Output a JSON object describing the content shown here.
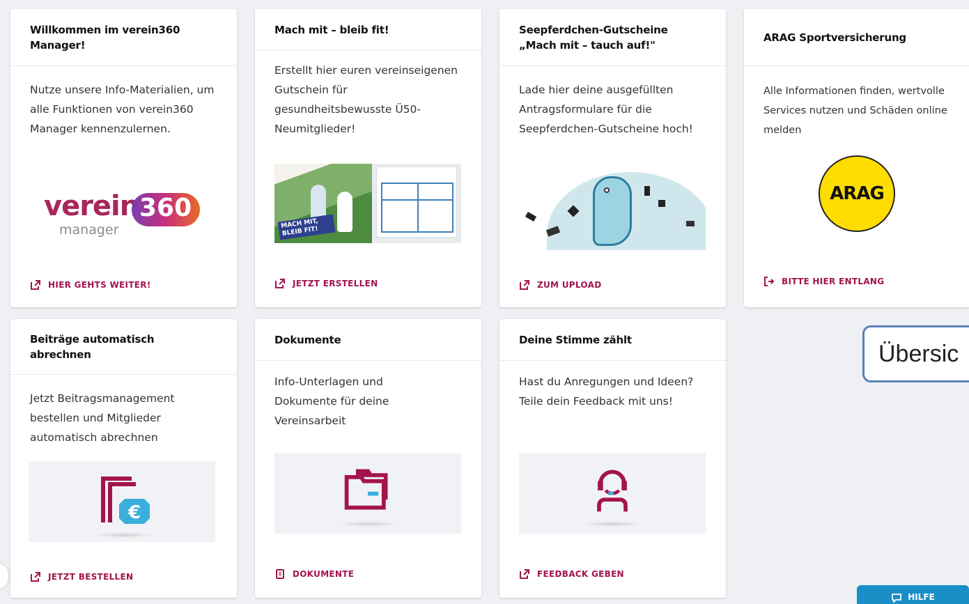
{
  "cards": [
    {
      "title": "Willkommen im verein360 Manager!",
      "text": "Nutze unsere Info-Materialien, um alle Funktionen von verein360 Manager kennenzulernen.",
      "link": "HIER GEHTS WEITER!",
      "logo_word": "verein",
      "logo_num": "360",
      "logo_sub": "manager"
    },
    {
      "title": "Mach mit – bleib fit!",
      "text": "Erstellt hier euren vereinseigenen Gutschein für gesundheitsbewusste Ü50-Neumitglieder!",
      "link": "JETZT ERSTELLEN",
      "banner": "MACH MIT, BLEIB FIT!"
    },
    {
      "title": "Seepferdchen-Gutscheine „Mach mit – tauch auf!\"",
      "text": "Lade hier deine ausgefüllten Antragsformulare für die Seepferdchen-Gutscheine hoch!",
      "link": "ZUM UPLOAD"
    },
    {
      "title": "ARAG Sportversicherung",
      "text": "Alle Informationen finden, wertvolle Services nutzen und Schäden online melden",
      "link": "BITTE HIER ENTLANG",
      "logo": "ARAG"
    },
    {
      "title": "Beiträge automatisch abrechnen",
      "text": "Jetzt Beitragsmanagement bestellen und Mitglieder automatisch abrechnen",
      "link": "JETZT BESTELLEN"
    },
    {
      "title": "Dokumente",
      "text": "Info-Unterlagen und Dokumente für deine Vereinsarbeit",
      "link": "DOKUMENTE"
    },
    {
      "title": "Deine Stimme zählt",
      "text": "Hast du Anregungen und Ideen? Teile dein Feedback mit uns!",
      "link": "FEEDBACK GEBEN"
    }
  ],
  "overlay": {
    "label": "Übersic"
  },
  "help": {
    "label": "HILFE"
  },
  "colors": {
    "accent": "#a3144e",
    "help": "#1a8fc7",
    "arag_yellow": "#ffdd00"
  }
}
